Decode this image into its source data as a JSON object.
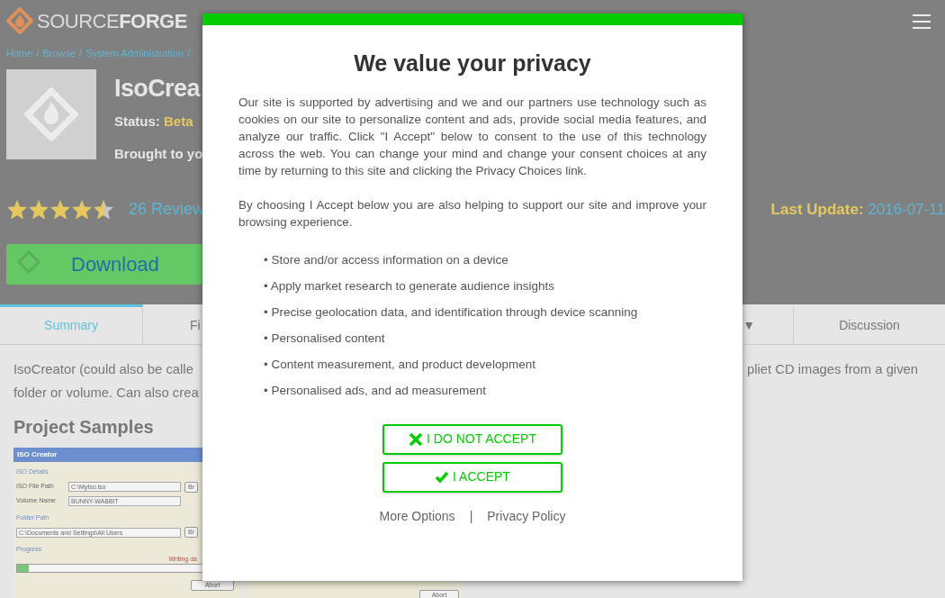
{
  "header": {
    "logo_light": "SOURCE",
    "logo_bold": "FORGE"
  },
  "breadcrumb": {
    "items": [
      "Home",
      "Browse",
      "System Administration"
    ],
    "separator": "/"
  },
  "project": {
    "title": "IsoCrea",
    "status_label": "Status:",
    "status": "Beta",
    "brought": "Brought to yo"
  },
  "rating": {
    "stars": 4.5,
    "reviews": "26 Review"
  },
  "last_update": {
    "label": "Last Update:",
    "date": "2016-07-11"
  },
  "download": {
    "label": "Download"
  },
  "tabs": [
    {
      "label": "Summary",
      "selected": true
    },
    {
      "label": "Fi",
      "selected": false
    },
    {
      "label": "▼",
      "selected": false
    },
    {
      "label": "Discussion",
      "selected": false
    }
  ],
  "description": {
    "left": [
      "IsoCreator (could also be calle",
      "folder or volume. Can also crea"
    ],
    "right": "pliet CD images from a given"
  },
  "samples_heading": "Project Samples",
  "samples": [
    {
      "kind": "form",
      "title": "ISO Creator",
      "details_label": "ISO Details",
      "file_label": "ISO File Path",
      "file_value": "C:\\MyIso.iso",
      "volume_label": "Volume Name",
      "volume_value": "BUNNY-WABBIT",
      "browse_buttons": [
        "Br",
        "Br"
      ],
      "folder_label": "Folder Path",
      "folder_value": "C:\\Documents and Settings\\All Users",
      "progress_label": "Progress",
      "progress_status": "Writing da",
      "level": 0.06,
      "abort": "Abort"
    },
    {
      "kind": "partial",
      "abort": "Abort"
    }
  ],
  "consent": {
    "title": "We value your privacy",
    "paragraphs": [
      "Our site is supported by advertising and we and our partners use technology such as cookies on our site to personalize content and ads, provide social media features, and analyze our traffic. Click \"I Accept\" below to consent to the use of this technology across the web. You can change your mind and change your consent choices at any time by returning to this site and clicking the Privacy Choices link.",
      "By choosing I Accept below you are also helping to support our site and improve your browsing experience."
    ],
    "bullet": "•",
    "purposes": [
      "Store and/or access information on a device",
      "Apply market research to generate audience insights",
      "Precise geolocation data, and identification through device scanning",
      "Personalised content",
      "Content measurement, and product development",
      "Personalised ads, and ad measurement"
    ],
    "buttons": [
      {
        "kind": "reject",
        "label": "I DO NOT ACCEPT"
      },
      {
        "kind": "accept",
        "label": "I ACCEPT"
      }
    ],
    "links": [
      "More Options",
      "Privacy Policy"
    ],
    "link_separator": "|"
  }
}
